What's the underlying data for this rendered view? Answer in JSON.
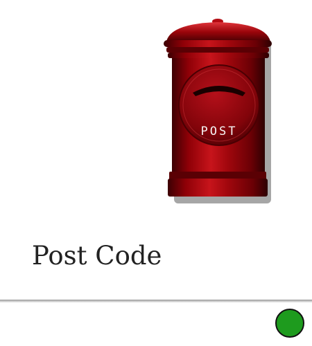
{
  "mailbox": {
    "icon": "post-box-icon",
    "label": "POST",
    "body_color": "#8f0007"
  },
  "page": {
    "title": "Post Code"
  },
  "status": {
    "icon": "status-circle-icon",
    "color": "#1e9b1e"
  }
}
